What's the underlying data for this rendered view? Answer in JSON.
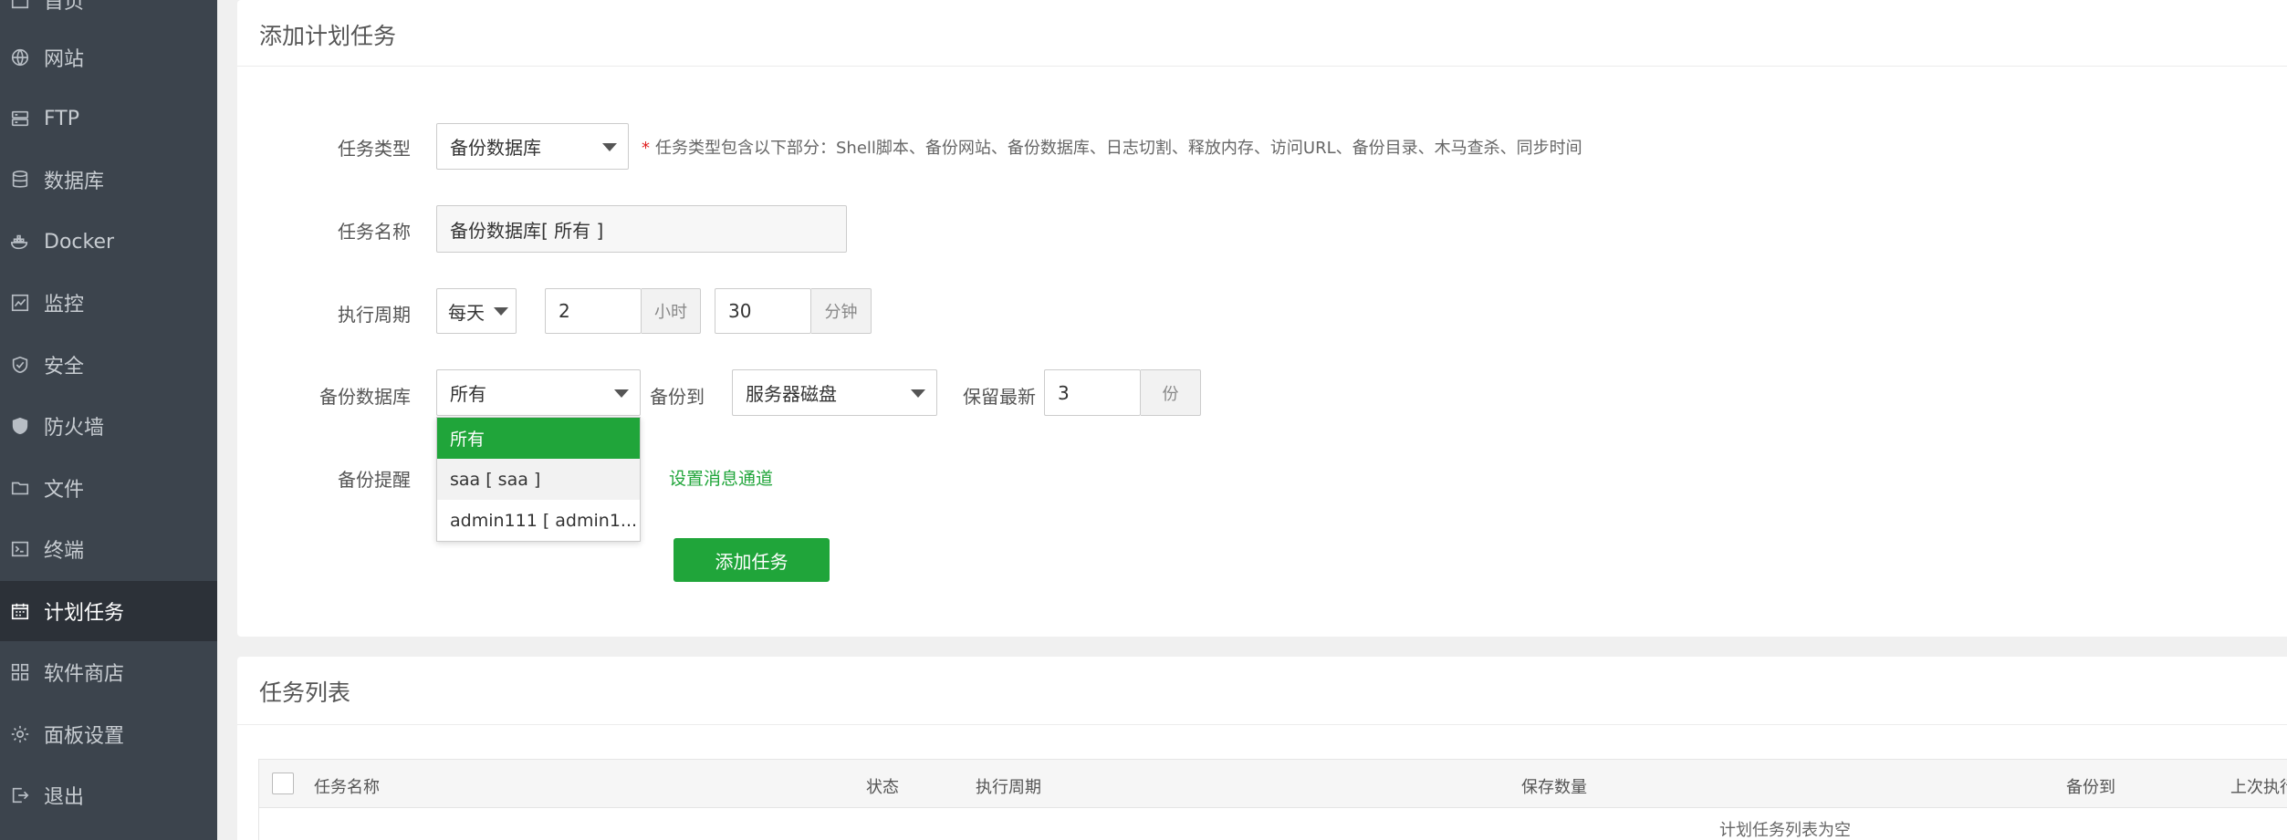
{
  "sidebar": {
    "items": [
      {
        "label": "首页",
        "icon": "home-icon"
      },
      {
        "label": "网站",
        "icon": "globe-icon"
      },
      {
        "label": "FTP",
        "icon": "ftp-icon"
      },
      {
        "label": "数据库",
        "icon": "database-icon"
      },
      {
        "label": "Docker",
        "icon": "docker-icon"
      },
      {
        "label": "监控",
        "icon": "monitor-icon"
      },
      {
        "label": "安全",
        "icon": "shield-icon"
      },
      {
        "label": "防火墙",
        "icon": "firewall-icon"
      },
      {
        "label": "文件",
        "icon": "folder-icon"
      },
      {
        "label": "终端",
        "icon": "terminal-icon"
      },
      {
        "label": "计划任务",
        "icon": "calendar-icon",
        "active": true
      },
      {
        "label": "软件商店",
        "icon": "apps-icon"
      },
      {
        "label": "面板设置",
        "icon": "gear-icon"
      },
      {
        "label": "退出",
        "icon": "logout-icon"
      }
    ]
  },
  "form": {
    "title": "添加计划任务",
    "task_type": {
      "label": "任务类型",
      "value": "备份数据库",
      "hint": "任务类型包含以下部分：Shell脚本、备份网站、备份数据库、日志切割、释放内存、访问URL、备份目录、木马查杀、同步时间"
    },
    "task_name": {
      "label": "任务名称",
      "value": "备份数据库[ 所有 ]"
    },
    "period": {
      "label": "执行周期",
      "freq": "每天",
      "hour": "2",
      "hour_unit": "小时",
      "minute": "30",
      "minute_unit": "分钟"
    },
    "backup_db": {
      "label": "备份数据库",
      "value": "所有",
      "options": [
        "所有",
        "saa [ saa ]",
        "admin111 [ admin1..."
      ]
    },
    "backup_to": {
      "label": "备份到",
      "value": "服务器磁盘"
    },
    "keep": {
      "label": "保留最新",
      "value": "3",
      "unit": "份"
    },
    "reminder": {
      "label": "备份提醒",
      "link": "设置消息通道"
    },
    "submit_label": "添加任务"
  },
  "task_list": {
    "title": "任务列表",
    "columns": [
      "任务名称",
      "状态",
      "执行周期",
      "保存数量",
      "备份到",
      "上次执行"
    ],
    "empty_text": "计划任务列表为空"
  },
  "colors": {
    "sidebar_bg": "#3c444d",
    "sidebar_active": "#2c3138",
    "accent": "#20a53a",
    "required": "#e02020"
  }
}
